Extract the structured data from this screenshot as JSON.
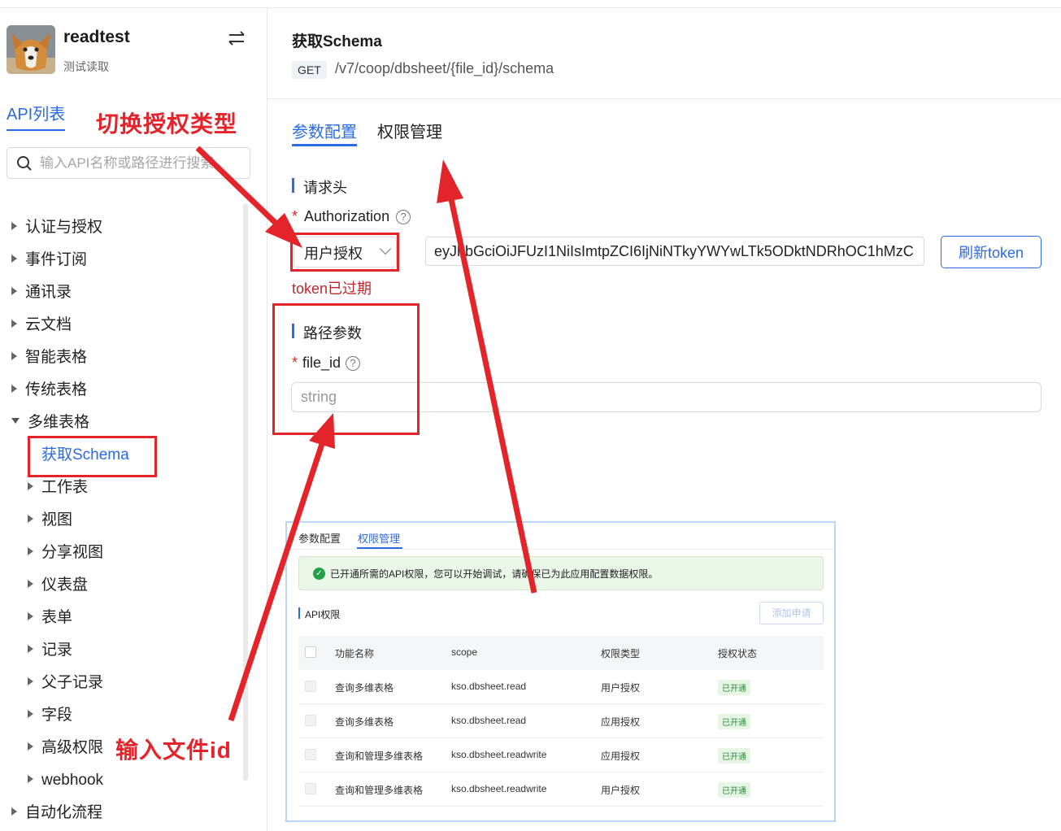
{
  "app": {
    "name": "readtest",
    "subtitle": "测试读取"
  },
  "sidebar": {
    "tab_label": "API列表",
    "search_placeholder": "输入API名称或路径进行搜索",
    "items": [
      {
        "label": "认证与授权",
        "level": 0,
        "expanded": false
      },
      {
        "label": "事件订阅",
        "level": 0,
        "expanded": false
      },
      {
        "label": "通讯录",
        "level": 0,
        "expanded": false
      },
      {
        "label": "云文档",
        "level": 0,
        "expanded": false
      },
      {
        "label": "智能表格",
        "level": 0,
        "expanded": false
      },
      {
        "label": "传统表格",
        "level": 0,
        "expanded": false
      },
      {
        "label": "多维表格",
        "level": 0,
        "expanded": true
      },
      {
        "label": "获取Schema",
        "level": 1,
        "selected": true
      },
      {
        "label": "工作表",
        "level": 1,
        "expanded": false
      },
      {
        "label": "视图",
        "level": 1,
        "expanded": false
      },
      {
        "label": "分享视图",
        "level": 1,
        "expanded": false
      },
      {
        "label": "仪表盘",
        "level": 1,
        "expanded": false
      },
      {
        "label": "表单",
        "level": 1,
        "expanded": false
      },
      {
        "label": "记录",
        "level": 1,
        "expanded": false
      },
      {
        "label": "父子记录",
        "level": 1,
        "expanded": false
      },
      {
        "label": "字段",
        "level": 1,
        "expanded": false
      },
      {
        "label": "高级权限",
        "level": 1,
        "expanded": false
      },
      {
        "label": "webhook",
        "level": 1,
        "expanded": false
      },
      {
        "label": "自动化流程",
        "level": 0,
        "expanded": false
      }
    ]
  },
  "annotations": {
    "switch_auth": "切换授权类型",
    "enter_file_id": "输入文件id"
  },
  "main": {
    "title": "获取Schema",
    "method": "GET",
    "path": "/v7/coop/dbsheet/{file_id}/schema",
    "tabs": [
      "参数配置",
      "权限管理"
    ],
    "active_tab": 0,
    "headers_section": "请求头",
    "auth_label": "Authorization",
    "auth_type_value": "用户授权",
    "token_value": "eyJhbGciOiJFUzI1NiIsImtpZCI6IjNiNTkyYWYwLTk5ODktNDRhOC1hMzC",
    "refresh_label": "刷新token",
    "token_status": "token已过期",
    "path_params_section": "路径参数",
    "file_id_label": "file_id",
    "file_id_placeholder": "string"
  },
  "embedded": {
    "tabs": [
      "参数配置",
      "权限管理"
    ],
    "active_tab": 1,
    "alert_text": "已开通所需的API权限，您可以开始调试，请确保已为此应用配置数据权限。",
    "section_title": "API权限",
    "add_button": "添加申请",
    "columns": [
      "功能名称",
      "scope",
      "权限类型",
      "授权状态"
    ],
    "rows": [
      {
        "name": "查询多维表格",
        "scope": "kso.dbsheet.read",
        "type": "用户授权",
        "status": "已开通"
      },
      {
        "name": "查询多维表格",
        "scope": "kso.dbsheet.read",
        "type": "应用授权",
        "status": "已开通"
      },
      {
        "name": "查询和管理多维表格",
        "scope": "kso.dbsheet.readwrite",
        "type": "应用授权",
        "status": "已开通"
      },
      {
        "name": "查询和管理多维表格",
        "scope": "kso.dbsheet.readwrite",
        "type": "用户授权",
        "status": "已开通"
      }
    ]
  },
  "colors": {
    "accent": "#2b6be6",
    "annotation_red": "#e3242b",
    "success": "#24a148"
  }
}
